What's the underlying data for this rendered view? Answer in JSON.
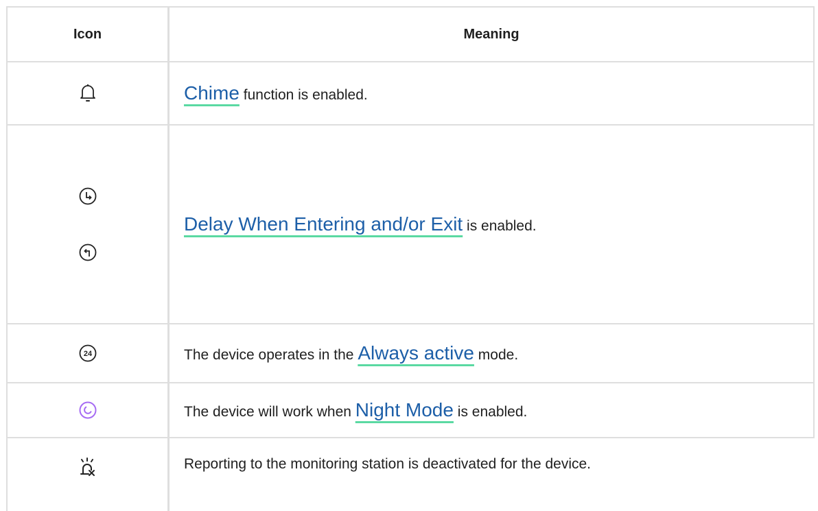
{
  "header": {
    "icon": "Icon",
    "meaning": "Meaning"
  },
  "rows": [
    {
      "icons": [
        "bell-icon"
      ],
      "pre": "",
      "link": "Chime",
      "post": " function is enabled."
    },
    {
      "icons": [
        "clock-enter-icon",
        "clock-exit-icon"
      ],
      "pre": "",
      "link": "Delay When Entering and/or Exit",
      "post": " is enabled."
    },
    {
      "icons": [
        "always-active-24-icon"
      ],
      "pre": "The device operates in the ",
      "link": "Always active",
      "post": " mode."
    },
    {
      "icons": [
        "night-mode-icon"
      ],
      "pre": "The device will work when ",
      "link": "Night Mode",
      "post": " is enabled."
    },
    {
      "icons": [
        "siren-off-icon"
      ],
      "pre": "Reporting to the monitoring station is deactivated for the device.",
      "link": "",
      "post": ""
    }
  ],
  "colors": {
    "link": "#1d5fa8",
    "underline": "#5ad9a2",
    "border": "#dedede",
    "night_mode": "#a66cf3"
  }
}
